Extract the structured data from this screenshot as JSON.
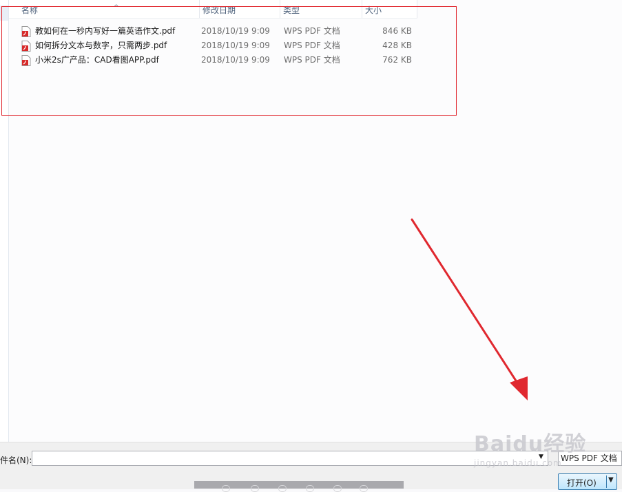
{
  "columns": {
    "name": "名称",
    "date": "修改日期",
    "type": "类型",
    "size": "大小"
  },
  "sort_indicator": "^",
  "files": [
    {
      "name": "教如何在一秒内写好一篇英语作文.pdf",
      "date": "2018/10/19 9:09",
      "type": "WPS PDF 文档",
      "size": "846 KB"
    },
    {
      "name": "如何拆分文本与数字，只需两步.pdf",
      "date": "2018/10/19 9:09",
      "type": "WPS PDF 文档",
      "size": "428 KB"
    },
    {
      "name": "小米2s广产品：CAD看图APP.pdf",
      "date": "2018/10/19 9:09",
      "type": "WPS PDF 文档",
      "size": "762 KB"
    }
  ],
  "bottom": {
    "filename_label": "件名(N):",
    "filename_value": "",
    "filetype_value": "WPS PDF 文档",
    "open_label": "打开(O)"
  },
  "watermark": {
    "logo": "Baidu经验",
    "url": "jingyan.baidu.com"
  },
  "colors": {
    "annotation": "#e0282f",
    "button_border": "#3c7fb1"
  },
  "icons": {
    "file": "pdf-file-icon",
    "dropdown": "chevron-down-icon",
    "annotation_arrow": "red-arrow"
  }
}
